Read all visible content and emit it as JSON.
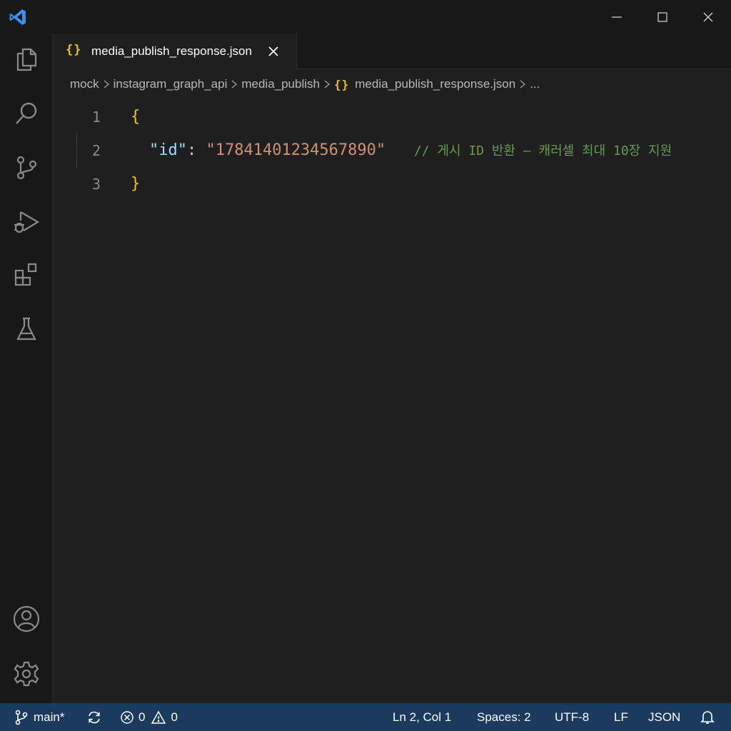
{
  "tab": {
    "label": "media_publish_response.json",
    "icon_text": "{}"
  },
  "breadcrumb": {
    "items": [
      "mock",
      "instagram_graph_api",
      "media_publish",
      "media_publish_response.json",
      "..."
    ],
    "file_icon_text": "{}"
  },
  "editor": {
    "lines": [
      {
        "number": "1",
        "open_brace": "{"
      },
      {
        "number": "2",
        "key": "\"id\"",
        "colon": ": ",
        "value": "\"17841401234567890\"",
        "comment": "// 게시 ID 반환 – 캐러셀 최대 10장 지원"
      },
      {
        "number": "3",
        "close_brace": "}"
      }
    ]
  },
  "statusbar": {
    "branch": "main*",
    "errors": "0",
    "warnings": "0",
    "cursor": "Ln 2, Col 1",
    "indent": "Spaces: 2",
    "encoding": "UTF-8",
    "eol": "LF",
    "language": "JSON"
  },
  "icons": {
    "app": "vscode-logo-icon",
    "activity": [
      "explorer-icon",
      "search-icon",
      "source-control-icon",
      "run-debug-icon",
      "extensions-icon",
      "testing-icon",
      "account-icon",
      "settings-gear-icon"
    ]
  },
  "colors": {
    "brace": "#f1c40f",
    "key": "#9cdcfe",
    "string": "#ce9178",
    "comment": "#6a9955",
    "statusbar": "#1b3a5e",
    "accent": "#3b8eea"
  }
}
